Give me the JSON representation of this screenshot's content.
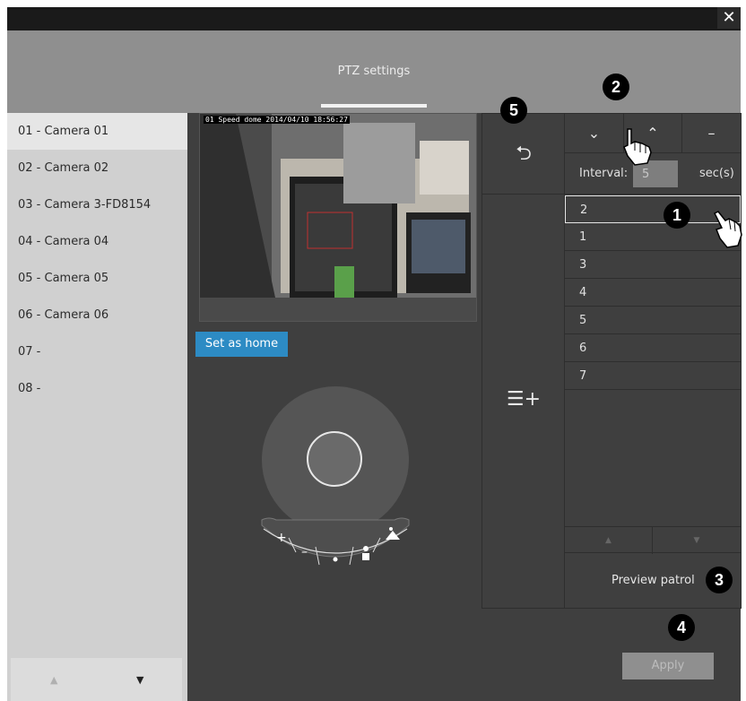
{
  "header": {
    "title": "PTZ settings",
    "close_icon": "close-icon"
  },
  "cameras": [
    "01 - Camera 01",
    "02 - Camera 02",
    "03 - Camera 3-FD8154",
    "04 - Camera 04",
    "05 - Camera 05",
    "06 - Camera 06",
    "07 -",
    "08 -"
  ],
  "selected_camera": 0,
  "preview": {
    "caption": "01 Speed dome 2014/04/10 18:56:27"
  },
  "set_home_label": "Set as home",
  "interval": {
    "label": "Interval:",
    "value": "5",
    "unit": "sec(s)"
  },
  "presets": [
    "2",
    "1",
    "3",
    "4",
    "5",
    "6",
    "7"
  ],
  "selected_preset": 0,
  "preview_patrol_label": "Preview patrol",
  "apply_label": "Apply",
  "callouts": {
    "c1": "1",
    "c2": "2",
    "c3": "3",
    "c4": "4",
    "c5": "5"
  },
  "colors": {
    "accent": "#2d8bc4",
    "panel": "#3f3f3f",
    "sidebar": "#d0d0d0",
    "header": "#8f8f8f"
  }
}
